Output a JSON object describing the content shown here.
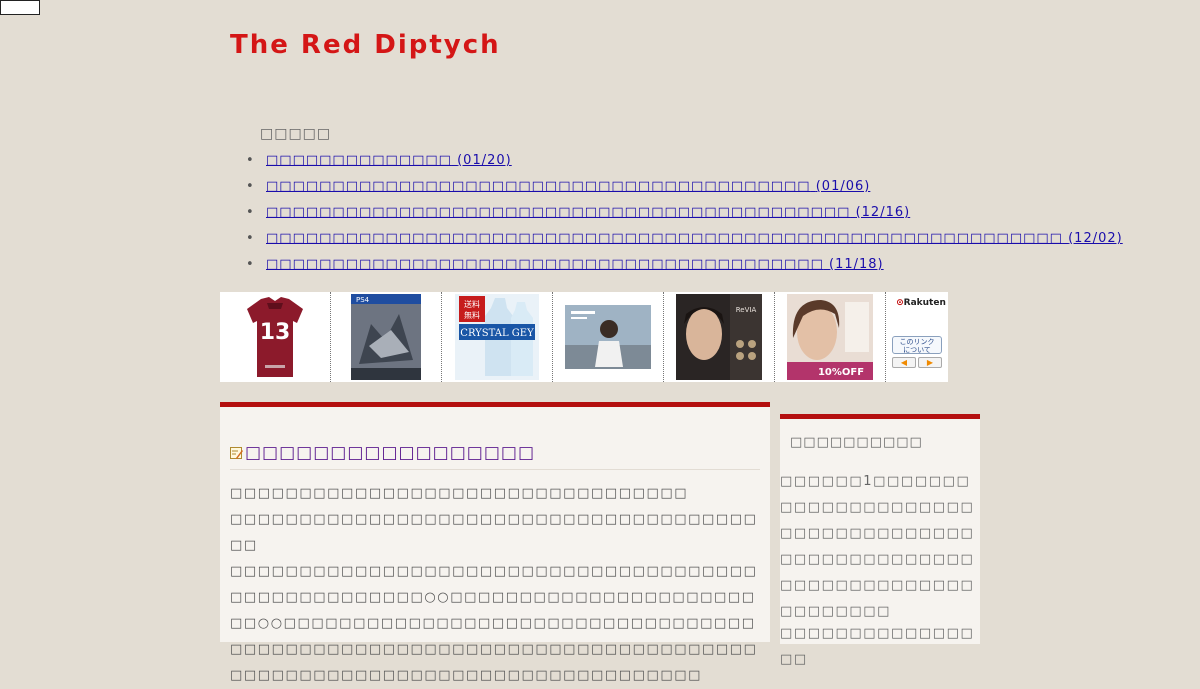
{
  "header": {
    "site_title": "The Red Diptych"
  },
  "recent": {
    "heading": "□□□□□",
    "items": [
      {
        "title": "□□□□□□□□□□□□□□",
        "date": "(01/20)"
      },
      {
        "title": "□□□□□□□□□□□□□□□□□□□□□□□□□□□□□□□□□□□□□□□□□",
        "date": "(01/06)"
      },
      {
        "title": "□□□□□□□□□□□□□□□□□□□□□□□□□□□□□□□□□□□□□□□□□□□□",
        "date": "(12/16)"
      },
      {
        "title": "□□□□□□□□□□□□□□□□□□□□□□□□□□□□□□□□□□□□□□□□□□□□□□□□□□□□□□□□□□□□",
        "date": "(12/02)"
      },
      {
        "title": "□□□□□□□□□□□□□□□□□□□□□□□□□□□□□□□□□□□□□□□□□□",
        "date": "(11/18)"
      }
    ]
  },
  "ads": {
    "brand": "Rakuten",
    "info_line1": "このリンク",
    "info_line2": "について",
    "prev": "◀",
    "next": "▶",
    "products": [
      {
        "name": "jersey-13",
        "label": "13"
      },
      {
        "name": "monster-hunter-ps4",
        "label": "PS4"
      },
      {
        "name": "crystal-geyser-water",
        "label": "CRYSTAL GEY"
      },
      {
        "name": "cd-cover",
        "label": ""
      },
      {
        "name": "revia-1day",
        "label": "ReVIA"
      },
      {
        "name": "color-contact",
        "label": "10%OFF"
      }
    ],
    "water_badge": "送料無料"
  },
  "entry": {
    "title": "□□□□□□□□□□□□□□□□□",
    "body": [
      " □□□□□□□□□□□□□□□□□□□□□□□□□□□□□□□□□",
      "□□□□□□□□□□□□□□□□□□□□□□□□□□□□□□□□□□□□□□□□",
      "□□□□□□□□□□□□□□□□□□□□□□□□□□□□□□□□□□□□□□□□□□□□□□□□□□□□○○□□□□□□□□□□□□□□□□□□□□□□□□○○□□□□□□□□□□□□□□□□□□□□□□□□□□□□□□□□□□□□□□□□□□□□□□□□□□□□□□□□□□□□□□□□□□□□□□□□□□□□□□□□□□□□□□□□□□□□□□□□□□□□□□□□□□"
    ]
  },
  "sidebar": {
    "title": "□□□□□□□□□□",
    "text": "□□□□□□1□□□□□□□□□□□□□□□□□□□□□□□□□□□□□□□□□□□□□□□□□□□□□□□□□□□□□□□□□□□□□□□□□□□□□□□",
    "text2": "□□□□□□□□□□□□□□□□"
  }
}
